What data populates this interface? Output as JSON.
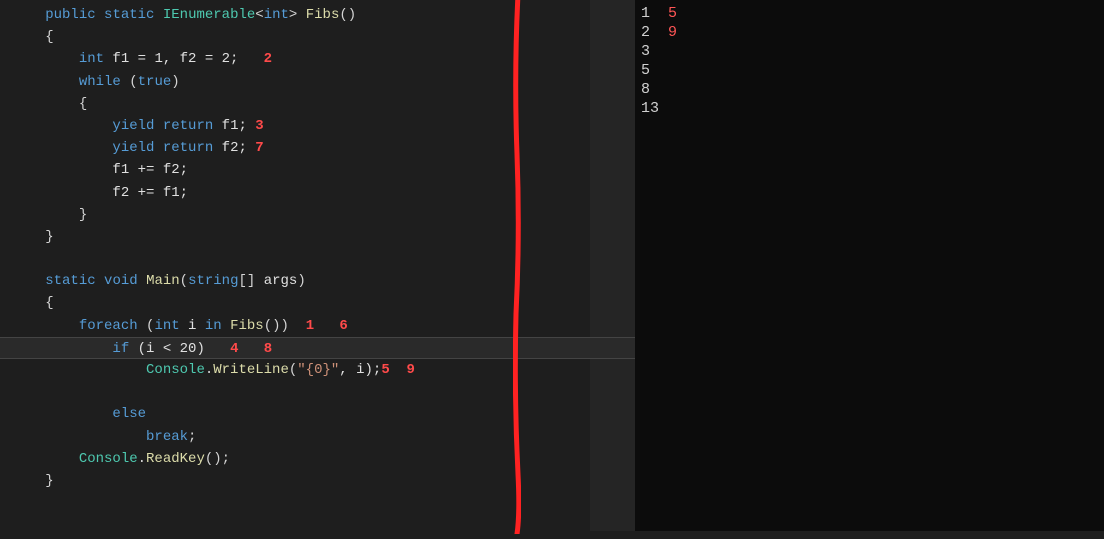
{
  "code": {
    "l1": {
      "kw1": "public",
      "kw2": "static",
      "type1": "IEnumerable",
      "type2": "int",
      "fn": "Fibs",
      "punA": "<",
      "punB": ">",
      "parens": "()"
    },
    "l2": {
      "brace": "{"
    },
    "l3": {
      "kw": "int",
      "a": " f1 = 1, f2 = 2;",
      "ann": "2"
    },
    "l4": {
      "kw": "while",
      "a": " (",
      "kw2": "true",
      "b": ")"
    },
    "l5": {
      "brace": "{"
    },
    "l6": {
      "kw1": "yield",
      "kw2": "return",
      "a": " f1;",
      "ann": "3"
    },
    "l7": {
      "kw1": "yield",
      "kw2": "return",
      "a": " f2;",
      "ann": "7"
    },
    "l8": {
      "a": "f1 += f2;"
    },
    "l9": {
      "a": "f2 += f1;"
    },
    "l10": {
      "brace": "}"
    },
    "l11": {
      "brace": "}"
    },
    "l12": {
      "kw1": "static",
      "kw2": "void",
      "fn": "Main",
      "p1": "(",
      "kw3": "string",
      "arr": "[]",
      "arg": " args",
      "p2": ")"
    },
    "l13": {
      "brace": "{"
    },
    "l14": {
      "kw": "foreach",
      "p1": " (",
      "kw2": "int",
      "a": " i ",
      "kw3": "in",
      "fn": " Fibs",
      "p2": "())",
      "ann1": "1",
      "ann2": "6"
    },
    "l15": {
      "kw": "if",
      "a": " (i < 20)",
      "ann1": "4",
      "ann2": "8"
    },
    "l16": {
      "cls": "Console",
      "dot": ".",
      "fn": "WriteLine",
      "p1": "(",
      "str": "\"{0}\"",
      "a": ", i);",
      "ann1": "5",
      "ann2": "9"
    },
    "l17": {
      "kw": "else"
    },
    "l18": {
      "kw": "break",
      "a": ";"
    },
    "l19": {
      "cls": "Console",
      "dot": ".",
      "fn": "ReadKey",
      "p": "();"
    },
    "l20": {
      "brace": "}"
    }
  },
  "output": {
    "r1a": "1",
    "r1b": "5",
    "r2a": "2",
    "r2b": "9",
    "r3": "3",
    "r4": "5",
    "r5": "8",
    "r6": "13"
  }
}
